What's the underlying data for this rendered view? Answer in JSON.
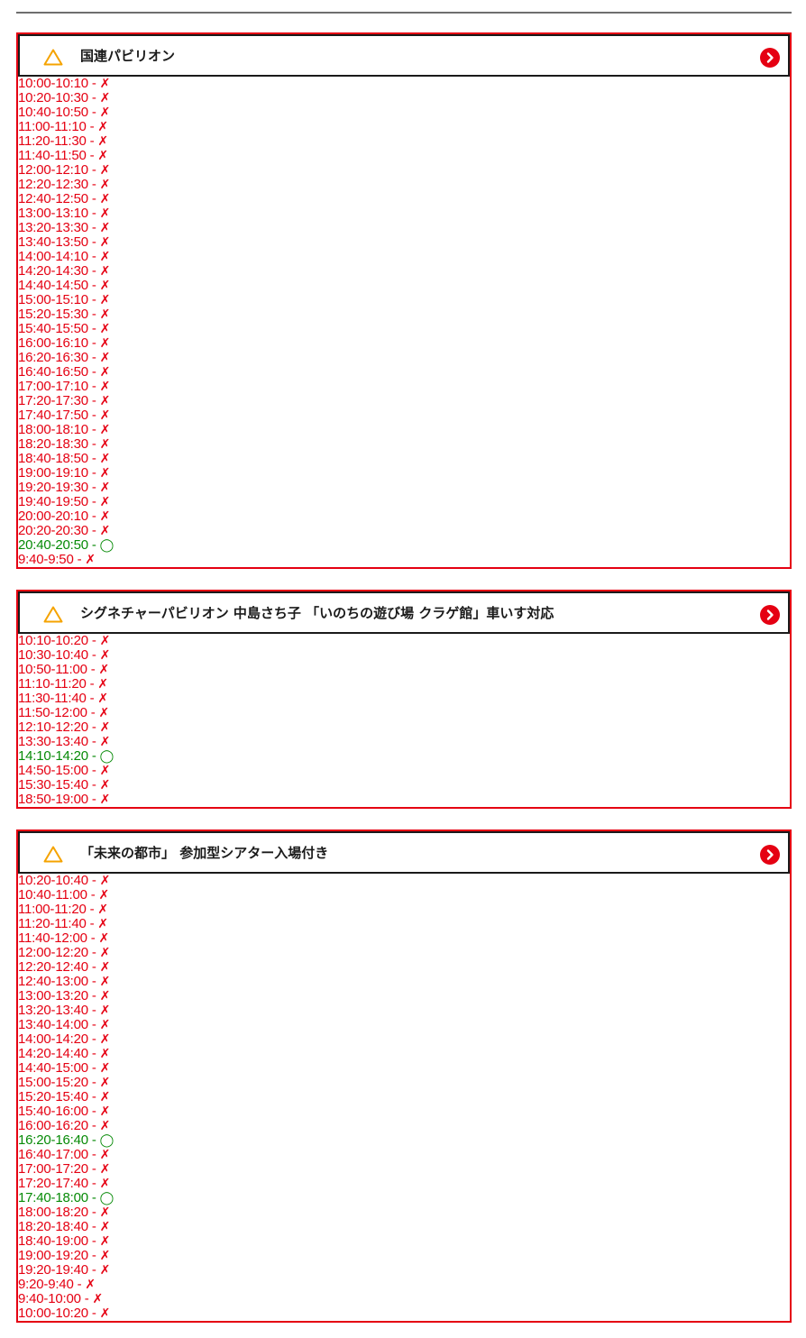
{
  "colors": {
    "full": "#e50012",
    "open": "#068a06",
    "border": "#e50012",
    "warning": "#f5a300"
  },
  "icons": {
    "warning": "warning-triangle-icon",
    "go": "chevron-right-circle-icon"
  },
  "separator": "-",
  "marks": {
    "full": "✗",
    "open": "◯"
  },
  "pavilions": [
    {
      "title": "国連パビリオン",
      "slots": [
        {
          "time": "10:00-10:10",
          "status": "full"
        },
        {
          "time": "10:20-10:30",
          "status": "full"
        },
        {
          "time": "10:40-10:50",
          "status": "full"
        },
        {
          "time": "11:00-11:10",
          "status": "full"
        },
        {
          "time": "11:20-11:30",
          "status": "full"
        },
        {
          "time": "11:40-11:50",
          "status": "full"
        },
        {
          "time": "12:00-12:10",
          "status": "full"
        },
        {
          "time": "12:20-12:30",
          "status": "full"
        },
        {
          "time": "12:40-12:50",
          "status": "full"
        },
        {
          "time": "13:00-13:10",
          "status": "full"
        },
        {
          "time": "13:20-13:30",
          "status": "full"
        },
        {
          "time": "13:40-13:50",
          "status": "full"
        },
        {
          "time": "14:00-14:10",
          "status": "full"
        },
        {
          "time": "14:20-14:30",
          "status": "full"
        },
        {
          "time": "14:40-14:50",
          "status": "full"
        },
        {
          "time": "15:00-15:10",
          "status": "full"
        },
        {
          "time": "15:20-15:30",
          "status": "full"
        },
        {
          "time": "15:40-15:50",
          "status": "full"
        },
        {
          "time": "16:00-16:10",
          "status": "full"
        },
        {
          "time": "16:20-16:30",
          "status": "full"
        },
        {
          "time": "16:40-16:50",
          "status": "full"
        },
        {
          "time": "17:00-17:10",
          "status": "full"
        },
        {
          "time": "17:20-17:30",
          "status": "full"
        },
        {
          "time": "17:40-17:50",
          "status": "full"
        },
        {
          "time": "18:00-18:10",
          "status": "full"
        },
        {
          "time": "18:20-18:30",
          "status": "full"
        },
        {
          "time": "18:40-18:50",
          "status": "full"
        },
        {
          "time": "19:00-19:10",
          "status": "full"
        },
        {
          "time": "19:20-19:30",
          "status": "full"
        },
        {
          "time": "19:40-19:50",
          "status": "full"
        },
        {
          "time": "20:00-20:10",
          "status": "full"
        },
        {
          "time": "20:20-20:30",
          "status": "full"
        },
        {
          "time": "20:40-20:50",
          "status": "open"
        },
        {
          "time": "9:40-9:50",
          "status": "full"
        }
      ]
    },
    {
      "title": "シグネチャーパビリオン 中島さち子 「いのちの遊び場 クラゲ館」車いす対応",
      "slots": [
        {
          "time": "10:10-10:20",
          "status": "full"
        },
        {
          "time": "10:30-10:40",
          "status": "full"
        },
        {
          "time": "10:50-11:00",
          "status": "full"
        },
        {
          "time": "11:10-11:20",
          "status": "full"
        },
        {
          "time": "11:30-11:40",
          "status": "full"
        },
        {
          "time": "11:50-12:00",
          "status": "full"
        },
        {
          "time": "12:10-12:20",
          "status": "full"
        },
        {
          "time": "13:30-13:40",
          "status": "full"
        },
        {
          "time": "14:10-14:20",
          "status": "open"
        },
        {
          "time": "14:50-15:00",
          "status": "full"
        },
        {
          "time": "15:30-15:40",
          "status": "full"
        },
        {
          "time": "18:50-19:00",
          "status": "full"
        }
      ]
    },
    {
      "title": "「未来の都市」 参加型シアター入場付き",
      "slots": [
        {
          "time": "10:20-10:40",
          "status": "full"
        },
        {
          "time": "10:40-11:00",
          "status": "full"
        },
        {
          "time": "11:00-11:20",
          "status": "full"
        },
        {
          "time": "11:20-11:40",
          "status": "full"
        },
        {
          "time": "11:40-12:00",
          "status": "full"
        },
        {
          "time": "12:00-12:20",
          "status": "full"
        },
        {
          "time": "12:20-12:40",
          "status": "full"
        },
        {
          "time": "12:40-13:00",
          "status": "full"
        },
        {
          "time": "13:00-13:20",
          "status": "full"
        },
        {
          "time": "13:20-13:40",
          "status": "full"
        },
        {
          "time": "13:40-14:00",
          "status": "full"
        },
        {
          "time": "14:00-14:20",
          "status": "full"
        },
        {
          "time": "14:20-14:40",
          "status": "full"
        },
        {
          "time": "14:40-15:00",
          "status": "full"
        },
        {
          "time": "15:00-15:20",
          "status": "full"
        },
        {
          "time": "15:20-15:40",
          "status": "full"
        },
        {
          "time": "15:40-16:00",
          "status": "full"
        },
        {
          "time": "16:00-16:20",
          "status": "full"
        },
        {
          "time": "16:20-16:40",
          "status": "open"
        },
        {
          "time": "16:40-17:00",
          "status": "full"
        },
        {
          "time": "17:00-17:20",
          "status": "full"
        },
        {
          "time": "17:20-17:40",
          "status": "full"
        },
        {
          "time": "17:40-18:00",
          "status": "open"
        },
        {
          "time": "18:00-18:20",
          "status": "full"
        },
        {
          "time": "18:20-18:40",
          "status": "full"
        },
        {
          "time": "18:40-19:00",
          "status": "full"
        },
        {
          "time": "19:00-19:20",
          "status": "full"
        },
        {
          "time": "19:20-19:40",
          "status": "full"
        },
        {
          "time": "9:20-9:40",
          "status": "full"
        },
        {
          "time": "9:40-10:00",
          "status": "full"
        },
        {
          "time": "10:00-10:20",
          "status": "full"
        }
      ]
    }
  ]
}
